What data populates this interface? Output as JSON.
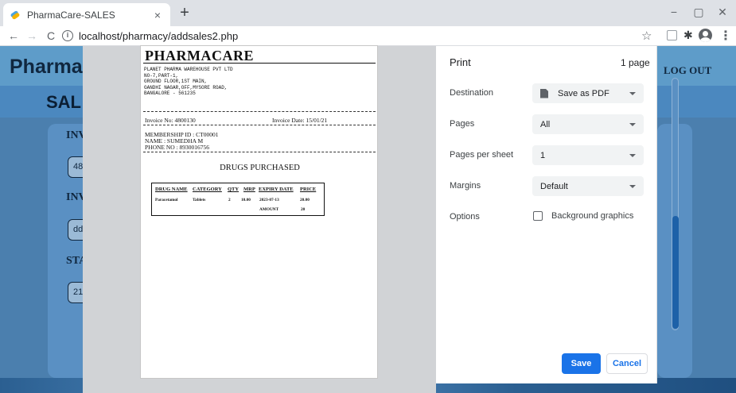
{
  "browser": {
    "tab_title": "PharmaCare-SALES",
    "tab_close": "×",
    "new_tab": "+",
    "url": "localhost/pharmacy/addsales2.php",
    "window_controls": {
      "minimize": "−",
      "maximize": "▢",
      "close": "✕"
    },
    "nav": {
      "back": "←",
      "forward": "→",
      "reload": "C"
    },
    "info_glyph": "i",
    "star_glyph": "☆",
    "extension_glyph": "✱",
    "menu_glyph": "⋮"
  },
  "page": {
    "brand": "Pharma",
    "logout": "LOG OUT",
    "sales_title": "SAL",
    "fields": [
      {
        "label": "INV",
        "value": "48"
      },
      {
        "label": "INV",
        "value": "dd"
      },
      {
        "label": "STA",
        "value": "21"
      }
    ]
  },
  "invoice": {
    "title": "PHARMACARE",
    "address": [
      "PLANET PHARMA WAREHOUSE PVT LTD",
      "NO-7,PART-1,",
      "GROUND FLOOR,1ST MAIN,",
      "GANDHI NAGAR,OFF,MYSORE ROAD,",
      "BANGALORE - 561235"
    ],
    "invoice_no": "Invoice No: 4800130",
    "invoice_date": "Invoice Date: 15/01/21",
    "membership_id": "MEMBERSHIP ID : CT00001",
    "name": "NAME : SUMEDHA M",
    "phone": "PHONE NO : 8930016756",
    "drugs_heading": "DRUGS PURCHASED",
    "table": {
      "headers": [
        "DRUG NAME",
        "CATEGORY",
        "QTY",
        "MRP",
        "EXPIRY DATE",
        "PRICE"
      ],
      "rows": [
        [
          "Paracetamol",
          "Tablets",
          "2",
          "10.00",
          "2023-07-13",
          "20.00"
        ]
      ],
      "amount_label": "AMOUNT",
      "amount_value": "20"
    }
  },
  "print_panel": {
    "title": "Print",
    "page_count": "1 page",
    "settings": [
      {
        "label": "Destination",
        "value": "Save as PDF"
      },
      {
        "label": "Pages",
        "value": "All"
      },
      {
        "label": "Pages per sheet",
        "value": "1"
      },
      {
        "label": "Margins",
        "value": "Default"
      }
    ],
    "options_label": "Options",
    "background_graphics": "Background graphics",
    "background_graphics_checked": false,
    "save": "Save",
    "cancel": "Cancel",
    "accent_color": "#1a73e8"
  }
}
